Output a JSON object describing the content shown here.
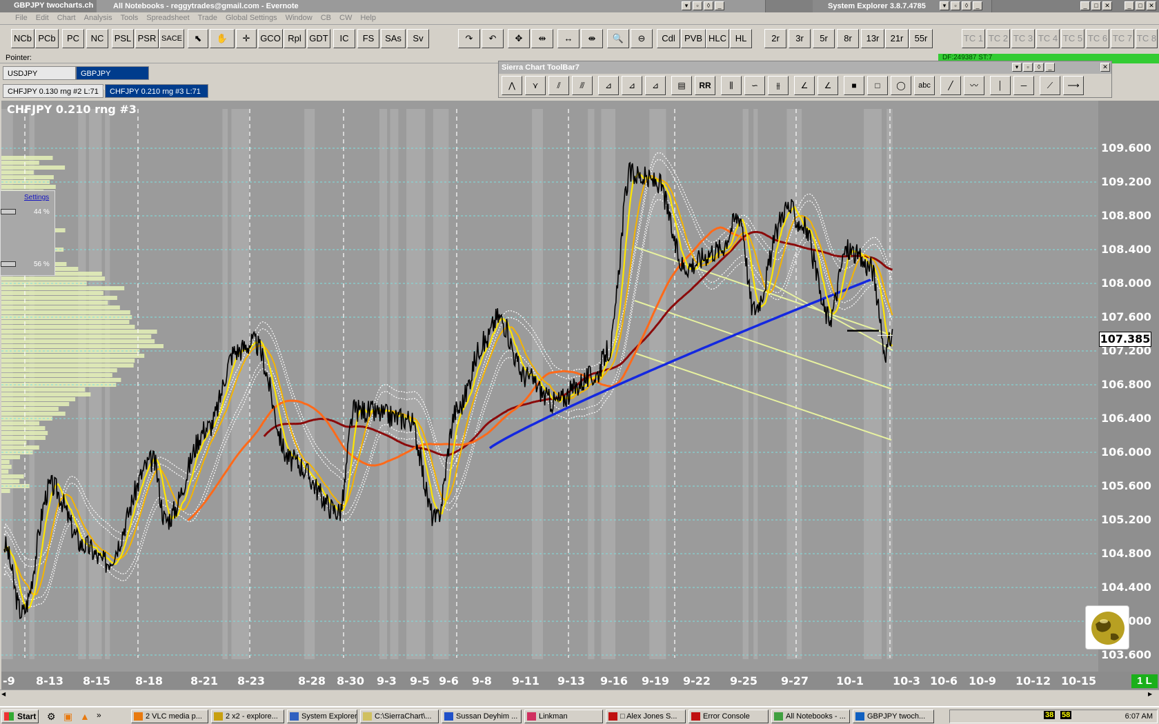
{
  "title_bar": {
    "app_title": "GBPJPY  twocharts.ch",
    "evernote_title": "All Notebooks - reggytrades@gmail.com - Evernote",
    "sysexp_title": "System Explorer 3.8.7.4785"
  },
  "menu": [
    "File",
    "Edit",
    "Chart",
    "Analysis",
    "Tools",
    "Spreadsheet",
    "Trade",
    "Global Settings",
    "Window",
    "CB",
    "CW",
    "Help"
  ],
  "toolbar": {
    "left": [
      "NCb",
      "PCb",
      "PC",
      "NC",
      "PSL",
      "PSR",
      "SACE",
      "GCO",
      "Rpl",
      "GDT",
      "IC",
      "FS",
      "SAs",
      "Sv"
    ],
    "mid": [
      "Cdl",
      "PVB",
      "HLC",
      "HL"
    ],
    "periods": [
      "2r",
      "3r",
      "5r",
      "8r",
      "13r",
      "21r",
      "55r"
    ],
    "tc": [
      "TC 1",
      "TC 2",
      "TC 3",
      "TC 4",
      "TC 5",
      "TC 6",
      "TC 7",
      "TC 8"
    ]
  },
  "pointer_label": "Pointer:",
  "status_text": "DF:249387  ST:7",
  "chartbook_tabs": [
    {
      "label": "USDJPY  twocharts",
      "active": false
    },
    {
      "label": "GBPJPY  twocharts",
      "active": true
    }
  ],
  "chart_tabs": [
    {
      "label": "CHFJPY  0.130 rng  #2  L:71",
      "active": false
    },
    {
      "label": "CHFJPY  0.210 rng  #3  L:71",
      "active": true
    }
  ],
  "float_toolbar": {
    "title": "Sierra Chart ToolBar7",
    "rr_label": "RR",
    "abc_label": "abc"
  },
  "chart": {
    "title": "CHFJPY  0.210 rng  #3",
    "current_price": "107.385",
    "settings_link": "Settings",
    "pct_top": "44 %",
    "pct_bottom": "56 %",
    "one_l": "1 L",
    "y_labels": [
      "109.600",
      "109.200",
      "108.800",
      "108.400",
      "108.000",
      "107.600",
      "107.200",
      "106.800",
      "106.400",
      "106.000",
      "105.600",
      "105.200",
      "104.800",
      "104.400",
      "104.000",
      "103.600"
    ],
    "x_labels": [
      "-9",
      "8-13",
      "8-15",
      "8-18",
      "8-21",
      "8-23",
      "8-28",
      "8-30",
      "9-3",
      "9-5",
      "9-6",
      "9-8",
      "9-11",
      "9-13",
      "9-16",
      "9-19",
      "9-22",
      "9-25",
      "9-27",
      "10-1",
      "10-3",
      "10-6",
      "10-9",
      "10-12",
      "10-15"
    ],
    "colors": {
      "background": "#9b9b9b",
      "price": "#000000",
      "ema_fast": "#ffe600",
      "ema_mid": "#f5b400",
      "ema_orange": "#ff6a1a",
      "ema_red": "#8b0a0a",
      "ema_blue": "#1428e0",
      "channel": "#e8f2a0",
      "band": "#ffffff"
    }
  },
  "taskbar": {
    "start": "Start",
    "tasks": [
      {
        "label": "2 VLC media p...",
        "icon": "vlc-icon"
      },
      {
        "label": "2 x2 - explore...",
        "icon": "explorer-icon"
      },
      {
        "label": "System Explorer",
        "icon": "system-explorer-icon"
      },
      {
        "label": "C:\\SierraChart\\...",
        "icon": "notepad-icon"
      },
      {
        "label": "Sussan Deyhim ...",
        "icon": "firefox-icon"
      },
      {
        "label": "Linkman",
        "icon": "linkman-icon"
      },
      {
        "label": "□ Alex Jones S...",
        "icon": "stop-icon"
      },
      {
        "label": "Error Console",
        "icon": "error-icon"
      },
      {
        "label": "All Notebooks - ...",
        "icon": "evernote-icon"
      },
      {
        "label": "GBPJPY  twoch...",
        "icon": "sierra-icon"
      }
    ],
    "tray_numbers": [
      "38",
      "58"
    ],
    "clock": "6:07 AM"
  }
}
